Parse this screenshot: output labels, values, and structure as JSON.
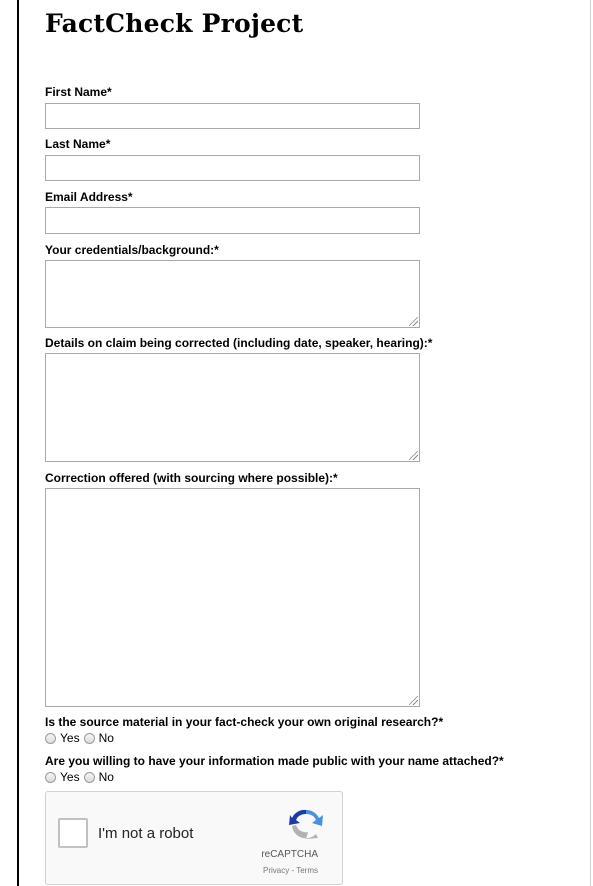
{
  "form": {
    "title": "FactCheck Project",
    "fields": {
      "first_name": {
        "label": "First Name*",
        "value": ""
      },
      "last_name": {
        "label": "Last Name*",
        "value": ""
      },
      "email": {
        "label": "Email Address*",
        "value": ""
      },
      "credentials": {
        "label": "Your credentials/background:*",
        "value": ""
      },
      "claim_details": {
        "label": "Details on claim being corrected (including date, speaker, hearing):*",
        "value": ""
      },
      "correction": {
        "label": "Correction offered (with sourcing where possible):*",
        "value": ""
      }
    },
    "questions": {
      "original_research": {
        "label": "Is the source material in your fact-check your own original research?*",
        "options": [
          "Yes",
          "No"
        ],
        "selected": null
      },
      "make_public": {
        "label": "Are you willing to have your information made public with your name attached?*",
        "options": [
          "Yes",
          "No"
        ],
        "selected": null
      }
    },
    "captcha": {
      "text": "I'm not a robot",
      "brand": "reCAPTCHA",
      "links": "Privacy - Terms",
      "checked": false,
      "colors": {
        "blue": "#4a90e2",
        "dark_blue": "#1c3aa9",
        "gray": "#b2b2b2"
      }
    }
  }
}
